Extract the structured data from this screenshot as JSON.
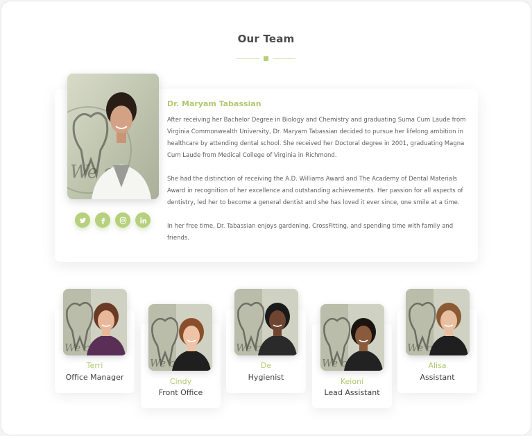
{
  "section": {
    "title": "Our Team"
  },
  "featured": {
    "name": "Dr. Maryam Tabassian",
    "bio": [
      "After receiving her Bachelor Degree in Biology and Chemistry and graduating Suma Cum Laude from Virginia Commonwealth University, Dr. Maryam Tabassian decided to pursue her lifelong ambition in healthcare by attending dental school.  She received her Doctoral degree in 2001, graduating Magna Cum Laude from Medical College of Virginia in Richmond.",
      "She had the distinction of receiving the A.D. Williams Award and The Academy of Dental Materials Award in recognition of her excellence and outstanding achievements. Her passion for all aspects of dentistry, led her to become a general dentist and she has loved it ever since, one smile at a time.",
      "In her free time, Dr. Tabassian enjoys gardening, CrossFitting, and spending time with family and friends."
    ],
    "socials": [
      "twitter-icon",
      "facebook-icon",
      "instagram-icon",
      "linkedin-icon"
    ]
  },
  "team": [
    {
      "name": "Terri",
      "role": "Office Manager",
      "hair": "#6b3a24",
      "skin": "#e8b89a",
      "shirt": "#5a2f55"
    },
    {
      "name": "Cindy",
      "role": "Front Office",
      "hair": "#8a4f2a",
      "skin": "#efc3a6",
      "shirt": "#1f1f1f"
    },
    {
      "name": "De",
      "role": "Hygienist",
      "hair": "#1a1a1a",
      "skin": "#6e4530",
      "shirt": "#2a2a2a"
    },
    {
      "name": "Keioni",
      "role": "Lead Assistant",
      "hair": "#1c1410",
      "skin": "#8a5a3c",
      "shirt": "#222222"
    },
    {
      "name": "Alisa",
      "role": "Assistant",
      "hair": "#8b5a34",
      "skin": "#e9bfa2",
      "shirt": "#1f1f1f"
    }
  ],
  "colors": {
    "accent": "#b7d07d",
    "accent_text": "#b1c96f",
    "text": "#5e5e5e"
  }
}
